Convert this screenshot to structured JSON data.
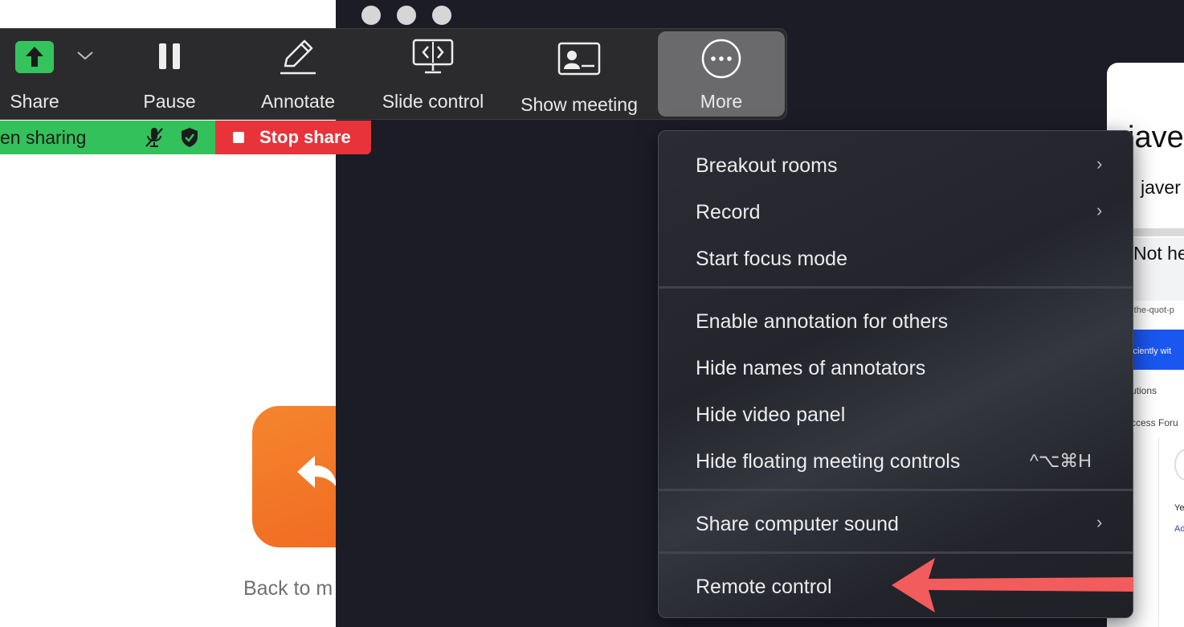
{
  "background_app": {
    "back_label": "Back to m"
  },
  "toolbar": {
    "share_label": "Share",
    "pause_label": "Pause",
    "annotate_label": "Annotate",
    "slide_control_label": "Slide control",
    "show_meeting_label": "Show meeting",
    "more_label": "More"
  },
  "status": {
    "sharing_text": "en sharing",
    "stop_share_label": "Stop share",
    "green_color": "#33c15c",
    "red_color": "#e8333a"
  },
  "menu": {
    "items": [
      {
        "label": "Breakout rooms",
        "submenu": true
      },
      {
        "label": "Record",
        "submenu": true
      },
      {
        "label": "Start focus mode"
      },
      {
        "label": "Enable annotation for others"
      },
      {
        "label": "Hide names of annotators"
      },
      {
        "label": "Hide video panel"
      },
      {
        "label": "Hide floating meeting controls",
        "shortcut": "^⌥⌘H"
      },
      {
        "label": "Share computer sound",
        "submenu": true
      },
      {
        "label": "Remote control"
      }
    ],
    "chevron": "›"
  },
  "peek_page": {
    "title": "javer",
    "name": "javer",
    "card_text": "Not he",
    "url": "-the-quot-p",
    "banner": "iciently wit",
    "solutions": "utions",
    "access": "ccess Foru",
    "ye": "Ye",
    "ad": "Ad"
  },
  "annotation": {
    "arrow_color": "#f25c5c"
  }
}
